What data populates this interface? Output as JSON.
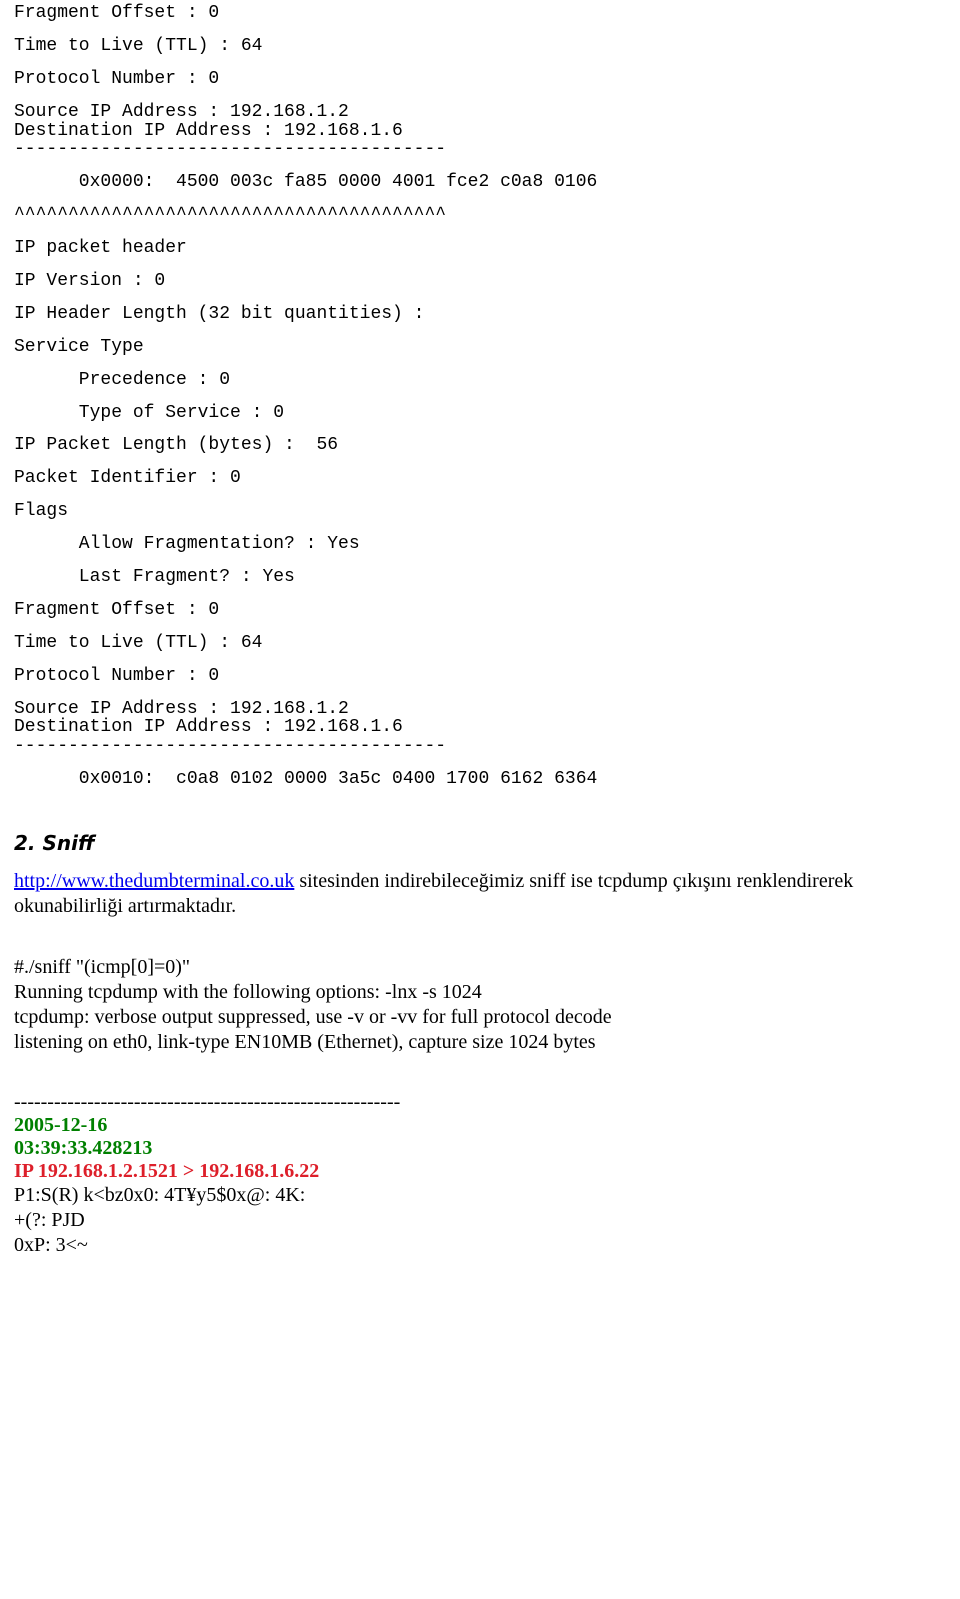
{
  "packet1": {
    "frag_offset": "Fragment Offset : 0",
    "ttl": "Time to Live (TTL) : 64",
    "proto": "Protocol Number : 0",
    "src": "Source IP Address : 192.168.1.2",
    "dst": "Destination IP Address : 192.168.1.6",
    "divider": "----------------------------------------",
    "hex": "      0x0000:  4500 003c fa85 0000 4001 fce2 c0a8 0106",
    "carets": "^^^^^^^^^^^^^^^^^^^^^^^^^^^^^^^^^^^^^^^^"
  },
  "header_decode": {
    "title": "IP packet header",
    "version": "IP Version : 0",
    "hlen": "IP Header Length (32 bit quantities) :",
    "svc_type": "Service Type",
    "precedence": "      Precedence : 0",
    "tos": "      Type of Service : 0",
    "pkt_len": "IP Packet Length (bytes) :  56",
    "pkt_id": "Packet Identifier : 0",
    "flags": "Flags",
    "allow_frag": "      Allow Fragmentation? : Yes",
    "last_frag": "      Last Fragment? : Yes",
    "frag_offset": "Fragment Offset : 0",
    "ttl": "Time to Live (TTL) : 64",
    "proto": "Protocol Number : 0",
    "src": "Source IP Address : 192.168.1.2",
    "dst": "Destination IP Address : 192.168.1.6",
    "divider": "----------------------------------------",
    "hex": "      0x0010:  c0a8 0102 0000 3a5c 0400 1700 6162 6364"
  },
  "sniff": {
    "heading": "2. Sniff",
    "link_text": "http://www.thedumbterminal.co.uk",
    "link_href": "http://www.thedumbterminal.co.uk",
    "desc_rest": " sitesinden indirebileceğimiz sniff ise tcpdump çıkışını renklendirerek okunabilirliği artırmaktadır."
  },
  "cmd": {
    "line1": "#./sniff  \"(icmp[0]=0)\"",
    "line2": "Running tcpdump with the following options: -lnx -s 1024",
    "line3": "tcpdump: verbose output suppressed, use -v or -vv for full protocol decode",
    "line4": "listening on eth0, link-type EN10MB (Ethernet), capture size 1024 bytes"
  },
  "capture": {
    "sep": "----------------------------------------------------------",
    "date": "2005-12-16",
    "time": "03:39:33.428213",
    "ips": "IP 192.168.1.2.1521 > 192.168.1.6.22",
    "p1": "P1:S(R) k<bz0x0:  4T¥y5$0x@:  4K:",
    "p2": "+(?:  PJD",
    "p3": "0xP:  3<~"
  }
}
